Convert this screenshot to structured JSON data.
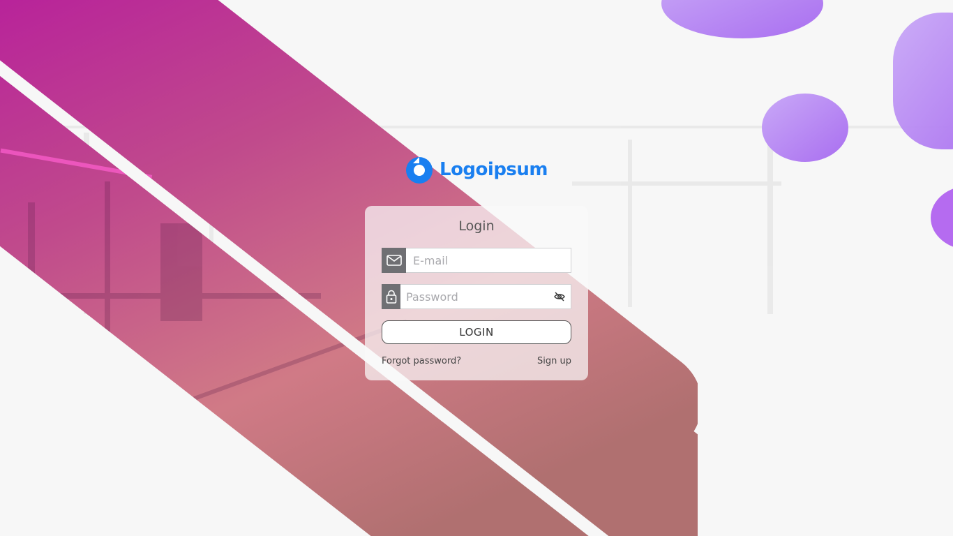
{
  "brand": {
    "logo_text": "Logoipsum",
    "logo_icon": "logoipsum-mark-icon",
    "color": "#1a7ff0"
  },
  "login": {
    "title": "Login",
    "email": {
      "value": "",
      "placeholder": "E-mail",
      "icon": "envelope-icon"
    },
    "password": {
      "value": "",
      "placeholder": "Password",
      "icon": "lock-icon",
      "toggle_icon": "eye-off-icon"
    },
    "button_label": "LOGIN",
    "forgot_label": "Forgot password?",
    "signup_label": "Sign up"
  },
  "theme": {
    "addon_bg": "#6f6f73",
    "pink_overlay": "#c0488f",
    "purple_blob": "#b27cf2"
  }
}
